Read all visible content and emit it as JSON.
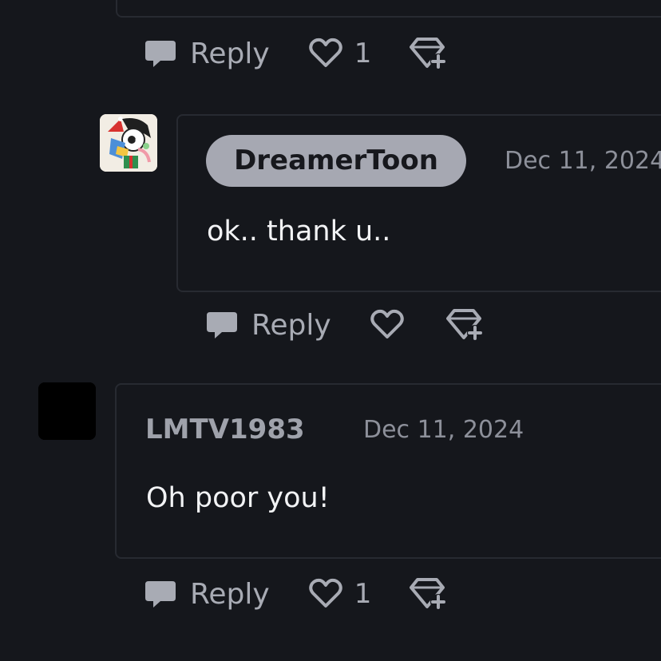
{
  "colors": {
    "background": "#15171c",
    "card_border": "#272a31",
    "action_gray": "#a8abb4",
    "pill_background": "#a6a8b2",
    "timestamp_gray": "#8d909a",
    "text_white": "#f2f3f5"
  },
  "thread": {
    "previous_actions": {
      "reply_label": "Reply",
      "like_count": "1",
      "icons": [
        "comment-icon",
        "heart-icon",
        "gem-plus-icon"
      ]
    },
    "comments": [
      {
        "username": "DreamerToon",
        "timestamp": "Dec 11, 2024",
        "text": "ok.. thank u..",
        "avatar_icon": "christmas-character-avatar",
        "actions": {
          "reply_label": "Reply",
          "like_count": ""
        }
      },
      {
        "username": "LMTV1983",
        "timestamp": "Dec 11, 2024",
        "text": "Oh poor you!",
        "avatar_icon": "black-avatar",
        "actions": {
          "reply_label": "Reply",
          "like_count": "1"
        }
      }
    ]
  }
}
